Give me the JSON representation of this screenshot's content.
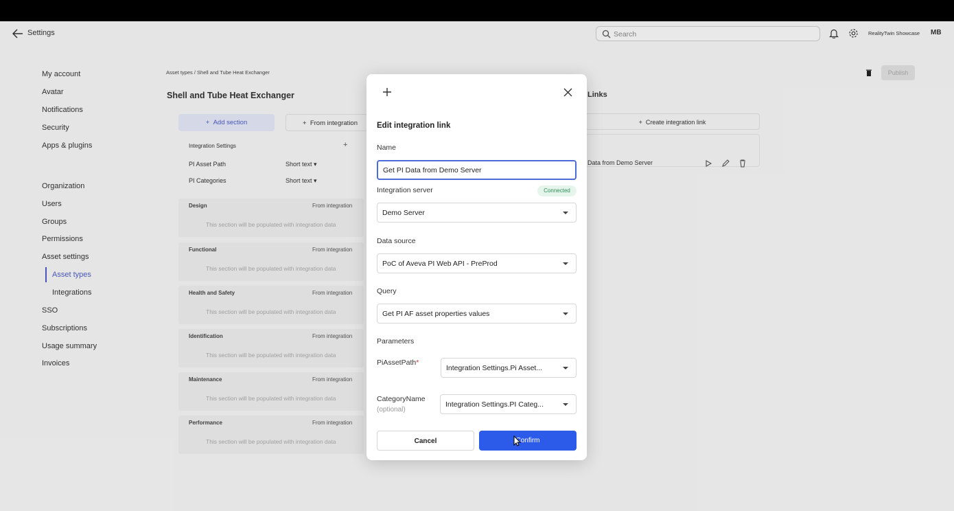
{
  "header": {
    "back_label": "Settings",
    "search_placeholder": "Search",
    "workspace": "RealityTwin Showcase",
    "avatar": "MB"
  },
  "sidebar": {
    "items": [
      "My account",
      "Avatar",
      "Notifications",
      "Security",
      "Apps & plugins",
      "Organization",
      "Users",
      "Groups",
      "Permissions",
      "Asset settings",
      "Asset types",
      "Integrations",
      "SSO",
      "Subscriptions",
      "Usage summary",
      "Invoices"
    ],
    "active": "Asset types"
  },
  "main": {
    "breadcrumb": "Asset types  /  Shell and Tube Heat Exchanger",
    "title": "Shell and Tube Heat Exchanger",
    "add_section": "Add section",
    "from_integration": "From integration",
    "integration_settings": "Integration Settings",
    "fields": [
      {
        "name": "PI Asset Path",
        "type": "Short text"
      },
      {
        "name": "PI Categories",
        "type": "Short text"
      }
    ],
    "sections": [
      {
        "title": "Design",
        "source": "From integration",
        "desc": "This section will be populated with integration data"
      },
      {
        "title": "Functional",
        "source": "From integration",
        "desc": "This section will be populated with integration data"
      },
      {
        "title": "Health and Safety",
        "source": "From integration",
        "desc": "This section will be populated with integration data"
      },
      {
        "title": "Identification",
        "source": "From integration",
        "desc": "This section will be populated with integration data"
      },
      {
        "title": "Maintenance",
        "source": "From integration",
        "desc": "This section will be populated with integration data"
      },
      {
        "title": "Performance",
        "source": "From integration",
        "desc": "This section will be populated with integration data"
      }
    ]
  },
  "links_panel": {
    "title": "Links",
    "create_button": "Create integration link",
    "link_name": "Data from Demo Server",
    "publish": "Publish"
  },
  "modal": {
    "title": "Edit integration link",
    "name_label": "Name",
    "name_value": "Get PI Data from Demo Server",
    "server_label": "Integration server",
    "server_status": "Connected",
    "server_value": "Demo Server",
    "datasource_label": "Data source",
    "datasource_value": "PoC of Aveva PI Web API - PreProd",
    "query_label": "Query",
    "query_value": "Get PI AF asset properties values",
    "parameters_label": "Parameters",
    "param1_label": "PiAssetPath",
    "param1_value": "Integration Settings.Pi Asset...",
    "param2_label": "CategoryName",
    "param2_optional": "(optional)",
    "param2_value": "Integration Settings.PI Categ...",
    "cancel": "Cancel",
    "confirm": "Confirm"
  },
  "colors": {
    "accent": "#2c5ae9",
    "active_nav": "#4b5cc4",
    "connected": "#2e8b57"
  }
}
